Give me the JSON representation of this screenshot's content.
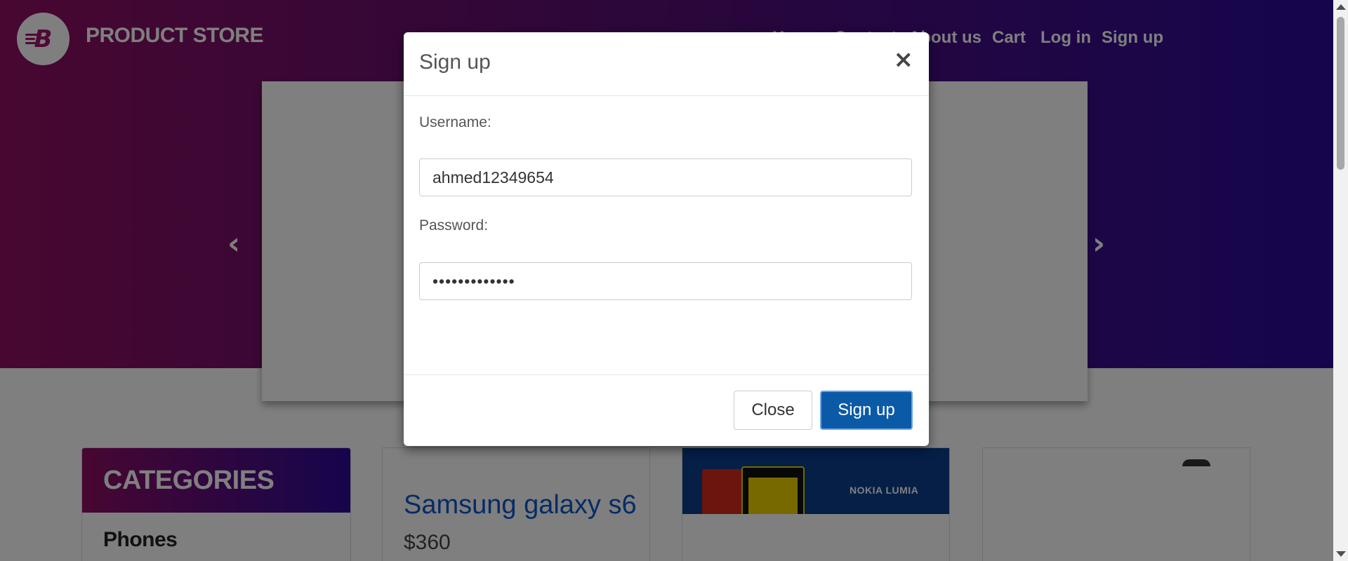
{
  "brand": {
    "name": "PRODUCT STORE",
    "logo_letter": "B"
  },
  "nav": {
    "items": [
      {
        "label": "Home"
      },
      {
        "label": "Contact"
      },
      {
        "label": "About us"
      },
      {
        "label": "Cart"
      },
      {
        "label": "Log in"
      },
      {
        "label": "Sign up"
      }
    ]
  },
  "carousel": {
    "prev_icon": "chevron-left-icon",
    "next_icon": "chevron-right-icon"
  },
  "categories": {
    "title": "CATEGORIES",
    "items": [
      "Phones"
    ]
  },
  "products": [
    {
      "title": "Samsung galaxy s6",
      "price": "$360"
    },
    {
      "banner_text": "NOKIA LUMIA"
    }
  ],
  "modal": {
    "title": "Sign up",
    "close_icon": "close-icon",
    "username_label": "Username:",
    "username_value": "ahmed12349654",
    "password_label": "Password:",
    "password_value": "•••••••••••••",
    "close_button": "Close",
    "signup_button": "Sign up"
  },
  "colors": {
    "primary_button": "#0b5aa8",
    "hero_start": "#8f0e62",
    "hero_end": "#2b0b9a",
    "link": "#0a58ca"
  }
}
